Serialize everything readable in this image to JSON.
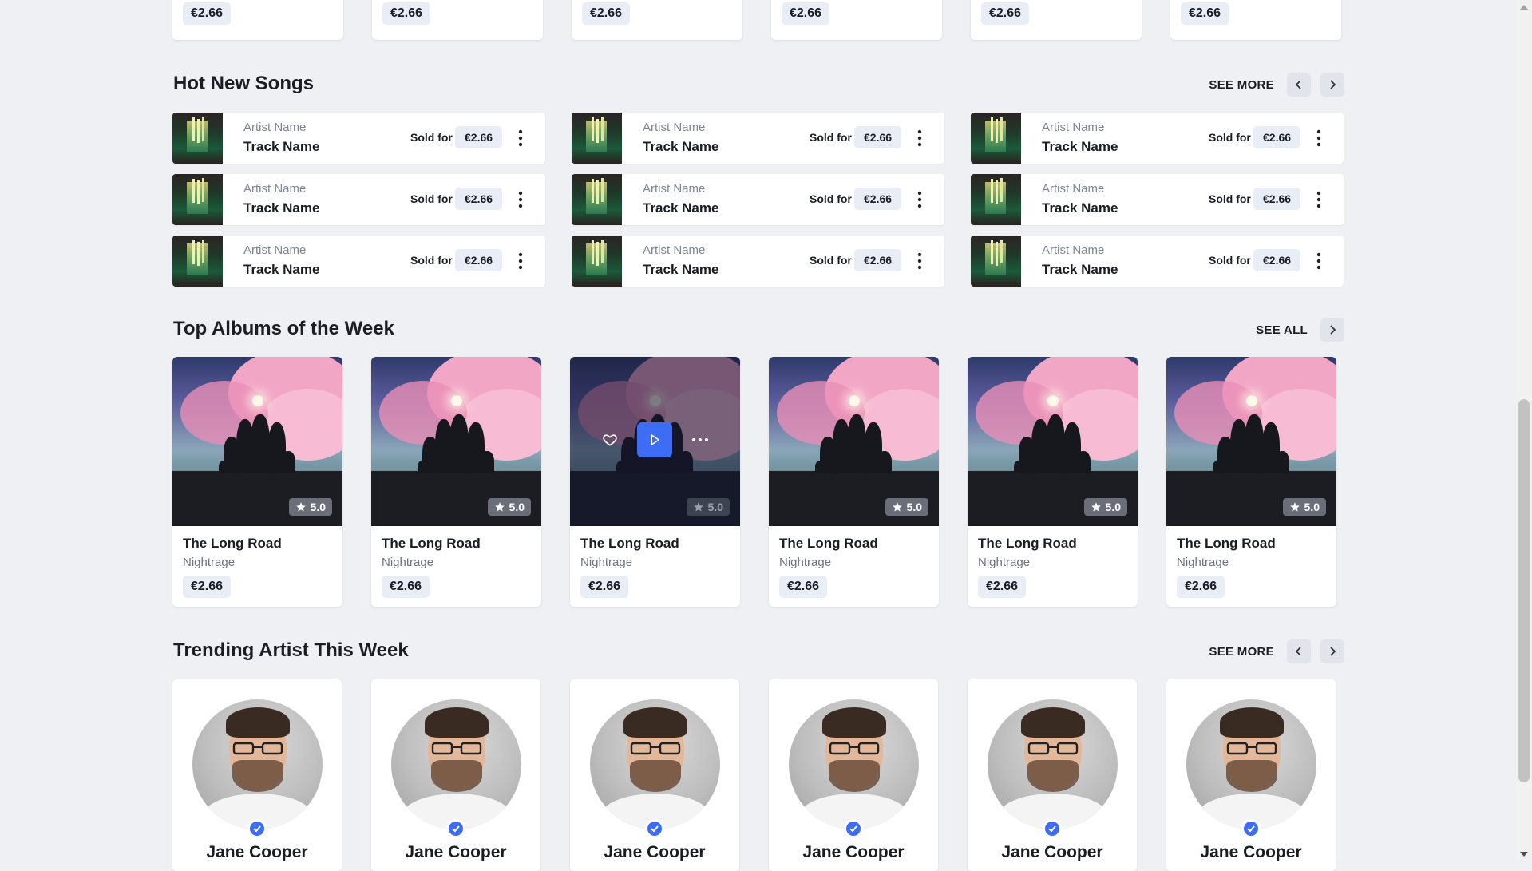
{
  "top_row": {
    "prices": [
      "€2.66",
      "€2.66",
      "€2.66",
      "€2.66",
      "€2.66",
      "€2.66"
    ]
  },
  "hot_songs": {
    "title": "Hot New Songs",
    "see_more": "SEE MORE",
    "items": [
      {
        "artist": "Artist Name",
        "track": "Track Name",
        "sold_label": "Sold for",
        "price": "€2.66"
      },
      {
        "artist": "Artist Name",
        "track": "Track Name",
        "sold_label": "Sold for",
        "price": "€2.66"
      },
      {
        "artist": "Artist Name",
        "track": "Track Name",
        "sold_label": "Sold for",
        "price": "€2.66"
      },
      {
        "artist": "Artist Name",
        "track": "Track Name",
        "sold_label": "Sold for",
        "price": "€2.66"
      },
      {
        "artist": "Artist Name",
        "track": "Track Name",
        "sold_label": "Sold for",
        "price": "€2.66"
      },
      {
        "artist": "Artist Name",
        "track": "Track Name",
        "sold_label": "Sold for",
        "price": "€2.66"
      },
      {
        "artist": "Artist Name",
        "track": "Track Name",
        "sold_label": "Sold for",
        "price": "€2.66"
      },
      {
        "artist": "Artist Name",
        "track": "Track Name",
        "sold_label": "Sold for",
        "price": "€2.66"
      },
      {
        "artist": "Artist Name",
        "track": "Track Name",
        "sold_label": "Sold for",
        "price": "€2.66"
      }
    ]
  },
  "top_albums": {
    "title": "Top Albums of the Week",
    "see_all": "SEE ALL",
    "items": [
      {
        "title": "The Long Road",
        "artist": "Nightrage",
        "price": "€2.66",
        "rating": "5.0"
      },
      {
        "title": "The Long Road",
        "artist": "Nightrage",
        "price": "€2.66",
        "rating": "5.0"
      },
      {
        "title": "The Long Road",
        "artist": "Nightrage",
        "price": "€2.66",
        "rating": "5.0",
        "hovered": true
      },
      {
        "title": "The Long Road",
        "artist": "Nightrage",
        "price": "€2.66",
        "rating": "5.0"
      },
      {
        "title": "The Long Road",
        "artist": "Nightrage",
        "price": "€2.66",
        "rating": "5.0"
      },
      {
        "title": "The Long Road",
        "artist": "Nightrage",
        "price": "€2.66",
        "rating": "5.0"
      }
    ]
  },
  "trending_artists": {
    "title": "Trending Artist This Week",
    "see_more": "SEE MORE",
    "items": [
      {
        "name": "Jane Cooper"
      },
      {
        "name": "Jane Cooper"
      },
      {
        "name": "Jane Cooper"
      },
      {
        "name": "Jane Cooper"
      },
      {
        "name": "Jane Cooper"
      },
      {
        "name": "Jane Cooper"
      }
    ]
  },
  "icons": {
    "prev": "chevron-left-icon",
    "next": "chevron-right-icon",
    "more": "kebab-icon",
    "star": "star-icon",
    "play": "play-icon",
    "like": "heart-icon",
    "options": "ellipsis-icon",
    "verified": "check-badge-icon"
  },
  "colors": {
    "background": "#eef0f4",
    "accent": "#3d6cf5",
    "price_pill": "#e9edf5"
  }
}
